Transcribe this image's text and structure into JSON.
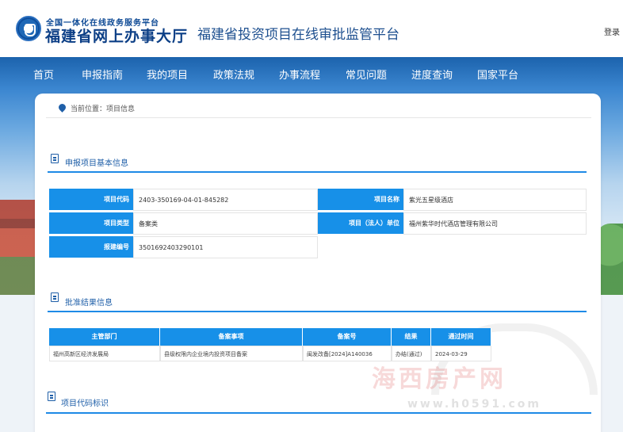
{
  "header": {
    "brand_top": "全国一体化在线政务服务平台",
    "brand_main": "福建省网上办事大厅",
    "platform_title": "福建省投资项目在线审批监管平台",
    "login": "登录"
  },
  "nav": {
    "items": [
      "首页",
      "申报指南",
      "我的项目",
      "政策法规",
      "办事流程",
      "常见问题",
      "进度查询",
      "国家平台"
    ]
  },
  "breadcrumb": "当前位置：项目信息",
  "basic_info": {
    "title": "申报项目基本信息",
    "labels": {
      "code": "项目代码",
      "name": "项目名称",
      "type": "项目类型",
      "unit": "项目（法人）单位",
      "filing_no": "报建编号"
    },
    "values": {
      "code": "2403-350169-04-01-845282",
      "name": "紫光五星级酒店",
      "type": "备案类",
      "unit": "福州紫华时代酒店管理有限公司",
      "filing_no": "3501692403290101"
    }
  },
  "approval": {
    "title": "批准结果信息",
    "headers": [
      "主管部门",
      "备案事项",
      "备案号",
      "结果",
      "通过时间"
    ],
    "row": [
      "福州高新区经济发展局",
      "县级权限内企业境内投资项目备案",
      "闽发改备[2024]A140036",
      "办结(通过)",
      "2024-03-29"
    ]
  },
  "code_section": {
    "title": "项目代码标识"
  },
  "watermark": {
    "text": "海西房产网",
    "url": "www.h0591.com"
  },
  "colors": {
    "primary": "#1790e8",
    "nav_bg": "#1c63ad",
    "title_blue": "#1f5fa8"
  }
}
